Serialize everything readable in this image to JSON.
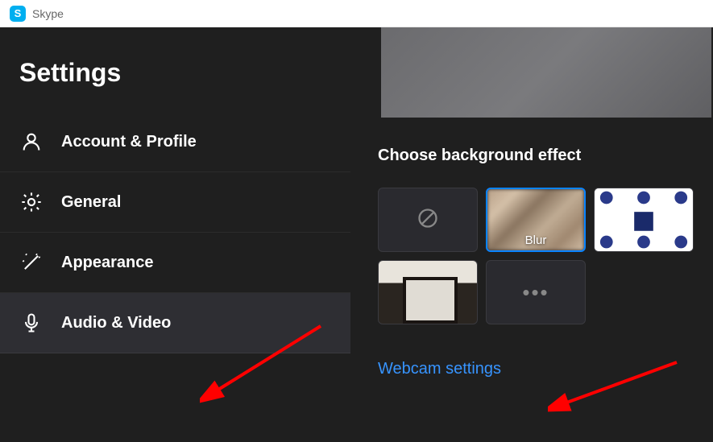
{
  "titlebar": {
    "logo_letter": "S",
    "app_name": "Skype"
  },
  "sidebar": {
    "title": "Settings",
    "items": [
      {
        "label": "Account & Profile"
      },
      {
        "label": "General"
      },
      {
        "label": "Appearance"
      },
      {
        "label": "Audio & Video"
      }
    ]
  },
  "content": {
    "section_title": "Choose background effect",
    "effects": {
      "blur_label": "Blur"
    },
    "webcam_link": "Webcam settings"
  }
}
